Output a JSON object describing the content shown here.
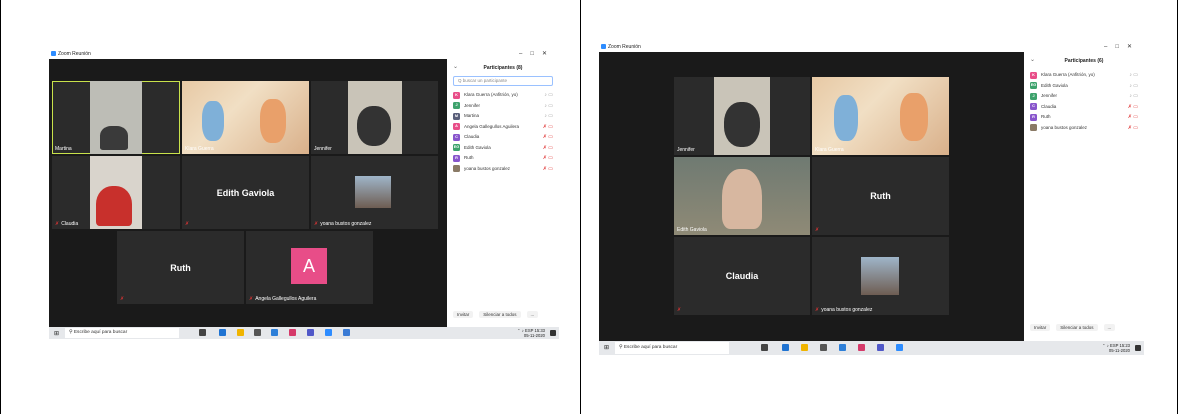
{
  "left": {
    "window_title": "Zoom Reunión",
    "panel_title": "Participantes (8)",
    "search_placeholder": "Q  buscar un participante",
    "participants": [
      {
        "initial": "K",
        "name": "Klara Guerra (Anfitrión, yo)",
        "color": "#e84d88",
        "muted": false
      },
      {
        "initial": "J",
        "name": "Jennifer",
        "color": "#3da26c",
        "muted": false
      },
      {
        "initial": "M",
        "name": "Martina",
        "color": "#5a5f7a",
        "muted": false
      },
      {
        "initial": "A",
        "name": "Angela Gallegullos Aguilera",
        "color": "#e84d88",
        "muted": true
      },
      {
        "initial": "C",
        "name": "Claudia",
        "color": "#8855cc",
        "muted": true
      },
      {
        "initial": "EG",
        "name": "Edith Gaviola",
        "color": "#3da26c",
        "muted": true
      },
      {
        "initial": "R",
        "name": "Ruth",
        "color": "#8855cc",
        "muted": true
      },
      {
        "initial": "",
        "name": "yoana bustos gonzalez",
        "color": "#8a7a66",
        "muted": true
      }
    ],
    "tiles": {
      "martina": "Martina",
      "klara": "Klara Guerra",
      "jennifer": "Jennifer",
      "claudia": "Claudia",
      "edith_big": "Edith Gaviola",
      "yoana": "yoana bustos gonzalez",
      "ruth_big": "Ruth",
      "angela_initial": "A",
      "angela": "Angela Gallegullos Aguilera"
    },
    "footer": {
      "invite": "Invitar",
      "mute_all": "Silenciar a todos",
      "more": "..."
    },
    "taskbar": {
      "search": "Escribe aquí para buscar",
      "time": "15:33",
      "date": "05-11-2020",
      "lang": "ESP"
    }
  },
  "right": {
    "window_title": "Zoom Reunión",
    "panel_title": "Participantes (6)",
    "participants": [
      {
        "initial": "K",
        "name": "Klara Guerra (Anfitrión, yo)",
        "color": "#e84d88",
        "muted": false
      },
      {
        "initial": "EG",
        "name": "Edith Gaviola",
        "color": "#3da26c",
        "muted": false
      },
      {
        "initial": "J",
        "name": "Jennifer",
        "color": "#3da26c",
        "muted": false
      },
      {
        "initial": "C",
        "name": "Claudia",
        "color": "#8855cc",
        "muted": true
      },
      {
        "initial": "R",
        "name": "Ruth",
        "color": "#8855cc",
        "muted": true
      },
      {
        "initial": "",
        "name": "yoana bustos gonzalez",
        "color": "#8a7a66",
        "muted": true
      }
    ],
    "tiles": {
      "jennifer": "Jennifer",
      "klara": "Klara Guerra",
      "edith": "Edith Gaviola",
      "ruth_big": "Ruth",
      "claudia_big": "Claudia",
      "yoana": "yoana bustos gonzalez"
    },
    "footer": {
      "invite": "Invitar",
      "mute_all": "Silenciar a todos",
      "more": "..."
    },
    "taskbar": {
      "search": "Escribe aquí para buscar",
      "time": "15:23",
      "date": "05-11-2020",
      "lang": "ESP"
    }
  },
  "colors": {
    "active_border": "#c9e24b",
    "mute_red": "#e03434",
    "zoom_blue": "#2d8cff",
    "tile_bg": "#2b2b2b"
  }
}
